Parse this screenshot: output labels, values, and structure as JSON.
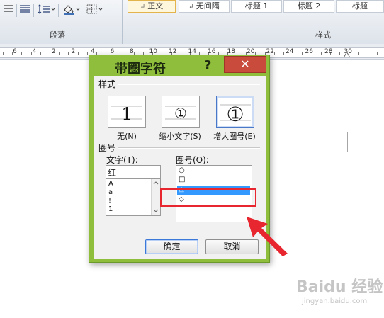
{
  "ribbon": {
    "group_label": "段落",
    "styles_label": "样式",
    "styles": [
      "正文",
      "无间隔",
      "标题 1",
      "标题 2",
      "标题"
    ],
    "active_style_index": 0
  },
  "ruler": {
    "numbers": [
      "6",
      "4",
      "2",
      "2",
      "4",
      "6",
      "8",
      "10",
      "12",
      "14",
      "16",
      "18",
      "20",
      "22",
      "24",
      "26",
      "28",
      "30"
    ]
  },
  "dialog": {
    "title": "带圈字符",
    "help": "?",
    "close": "✕",
    "section_style": "样式",
    "styles": [
      {
        "glyph": "1",
        "caption": "无(N)"
      },
      {
        "glyph": "①",
        "caption": "缩小文字(S)"
      },
      {
        "glyph": "①",
        "caption": "增大圈号(E)"
      }
    ],
    "selected_style_index": 2,
    "section_circle": "圈号",
    "text_label": "文字(T):",
    "text_value": "红",
    "text_list": [
      "A",
      "a",
      "!",
      "1"
    ],
    "circle_label": "圈号(O):",
    "circle_list": [
      "○",
      "□",
      "△",
      "◇"
    ],
    "selected_circle_index": 2,
    "ok": "确定",
    "cancel": "取消"
  },
  "colors": {
    "dialog_frame": "#8fbe3c",
    "close_button": "#c84b3c",
    "selection": "#3399ff",
    "annotation": "#e8262f"
  },
  "watermark": {
    "brand": "Baidu 经验",
    "url": "jingyan.baidu.com"
  }
}
